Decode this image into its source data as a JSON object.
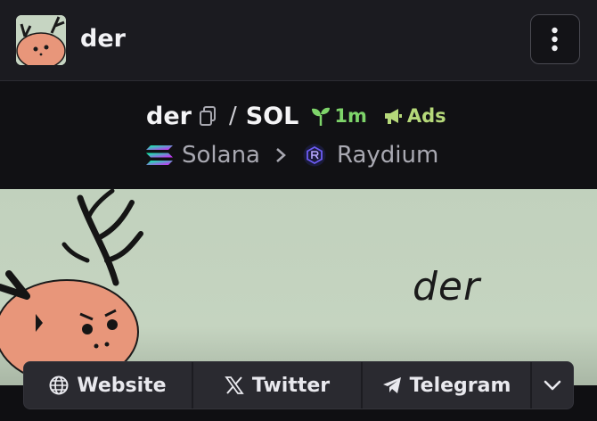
{
  "header": {
    "token_name": "der",
    "avatar_icon": "deer-avatar-icon",
    "menu_icon": "kebab-menu-icon"
  },
  "pair": {
    "base": "der",
    "separator": "/",
    "quote": "SOL",
    "age": "1m",
    "ads_label": "Ads",
    "copy_icon": "copy-icon",
    "age_icon": "sprout-icon",
    "ads_icon": "megaphone-icon"
  },
  "chain": {
    "name": "Solana",
    "dex": "Raydium",
    "chain_icon": "solana-icon",
    "dex_icon": "raydium-icon"
  },
  "banner": {
    "logo_text": "der"
  },
  "links": [
    {
      "label": "Website",
      "icon": "globe-icon"
    },
    {
      "label": "Twitter",
      "icon": "x-logo-icon"
    },
    {
      "label": "Telegram",
      "icon": "telegram-icon"
    }
  ],
  "colors": {
    "age_green": "#7ed46a",
    "ads_green": "#b6d97a",
    "banner_bg": "#c1d1bd"
  }
}
